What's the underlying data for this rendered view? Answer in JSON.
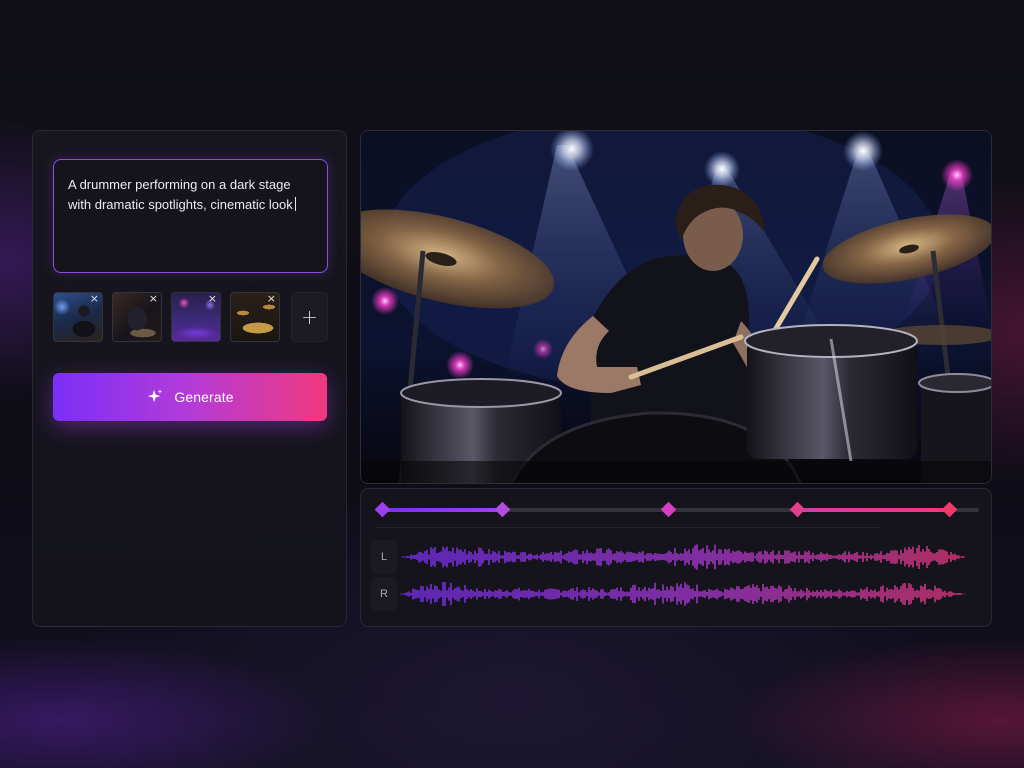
{
  "prompt": {
    "text": "A drummer performing on a dark stage\nwith dramatic spotlights, cinematic look"
  },
  "references": {
    "items": [
      {
        "name": "drummer-blue-light"
      },
      {
        "name": "drummer-close-up"
      },
      {
        "name": "concert-crowd-purple"
      },
      {
        "name": "drum-kit-cymbals"
      }
    ],
    "remove_glyph": "×",
    "add_glyph": "+"
  },
  "generate": {
    "label": "Generate",
    "icon": "sparkle-icon"
  },
  "timeline": {
    "keyframes": [
      {
        "color": "#9b3ff0"
      },
      {
        "color": "#b44be0"
      },
      {
        "color": "#d43ec0"
      },
      {
        "color": "#e23f8c"
      },
      {
        "color": "#f23a6a"
      }
    ],
    "channels": [
      {
        "label": "L"
      },
      {
        "label": "R"
      }
    ]
  },
  "colors": {
    "accent_start": "#7b2ff7",
    "accent_end": "#f0397e",
    "panel_bg": "#17161f",
    "page_bg": "#0d0c14"
  }
}
